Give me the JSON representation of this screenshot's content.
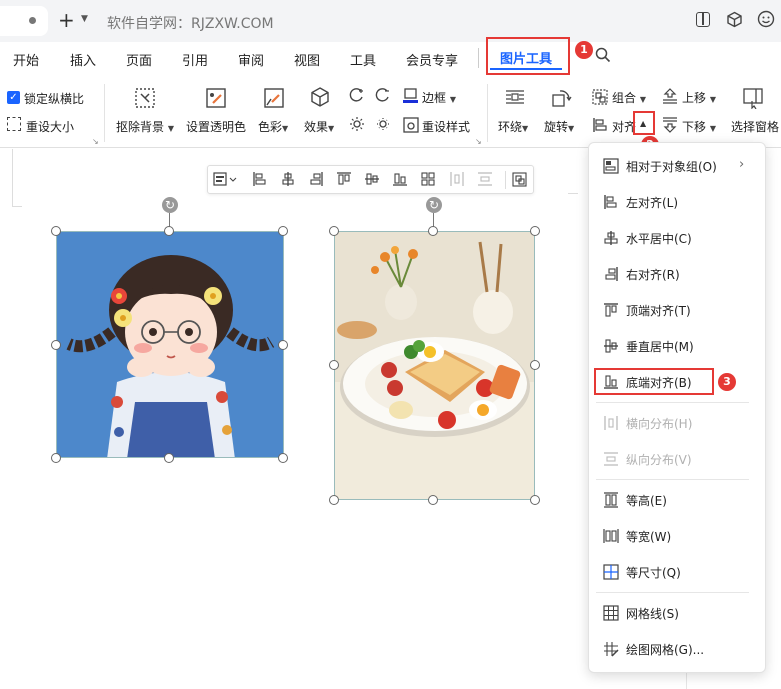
{
  "window": {
    "title": "软件自学网：RJZXW.COM"
  },
  "menu": {
    "items": [
      "开始",
      "插入",
      "页面",
      "引用",
      "审阅",
      "视图",
      "工具",
      "会员专享"
    ],
    "active": "图片工具"
  },
  "ribbon": {
    "lock_ratio": "锁定纵横比",
    "resize": "重设大小",
    "remove_bg": "抠除背景",
    "set_transparent": "设置透明色",
    "color": "色彩",
    "effect": "效果",
    "border": "边框",
    "reset_style": "重设样式",
    "wrap": "环绕",
    "rotate": "旋转",
    "group": "组合",
    "align": "对齐",
    "move_up": "上移",
    "move_down": "下移",
    "select_pane": "选择窗格"
  },
  "badges": [
    "1",
    "2",
    "3"
  ],
  "dropdown": {
    "items": [
      {
        "label": "相对于对象组(O)",
        "enabled": true,
        "submenu": true
      },
      {
        "label": "左对齐(L)",
        "enabled": true
      },
      {
        "label": "水平居中(C)",
        "enabled": true
      },
      {
        "label": "右对齐(R)",
        "enabled": true
      },
      {
        "label": "顶端对齐(T)",
        "enabled": true
      },
      {
        "label": "垂直居中(M)",
        "enabled": true
      },
      {
        "label": "底端对齐(B)",
        "enabled": true,
        "highlighted": true
      },
      {
        "label": "横向分布(H)",
        "enabled": false
      },
      {
        "label": "纵向分布(V)",
        "enabled": false
      },
      {
        "label": "等高(E)",
        "enabled": true
      },
      {
        "label": "等宽(W)",
        "enabled": true
      },
      {
        "label": "等尺寸(Q)",
        "enabled": true
      },
      {
        "label": "网格线(S)",
        "enabled": true
      },
      {
        "label": "绘图网格(G)...",
        "enabled": true
      }
    ]
  },
  "colors": {
    "accent": "#1a64ff",
    "highlight": "#e53935"
  }
}
